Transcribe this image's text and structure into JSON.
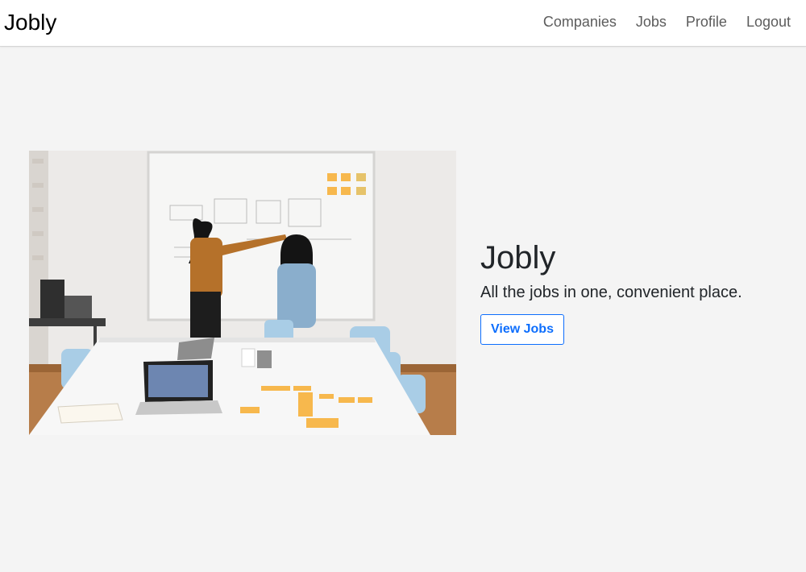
{
  "navbar": {
    "brand": "Jobly",
    "links": [
      {
        "label": "Companies"
      },
      {
        "label": "Jobs"
      },
      {
        "label": "Profile"
      },
      {
        "label": "Logout"
      }
    ]
  },
  "hero": {
    "image_alt": "two people working at a whiteboard",
    "title": "Jobly",
    "subtitle": "All the jobs in one, convenient place.",
    "cta_label": "View Jobs"
  },
  "colors": {
    "background": "#f4f4f4",
    "navbar": "#ffffff",
    "primary": "#0d6efd",
    "text": "#212529",
    "nav_text": "#5c5c5c"
  }
}
